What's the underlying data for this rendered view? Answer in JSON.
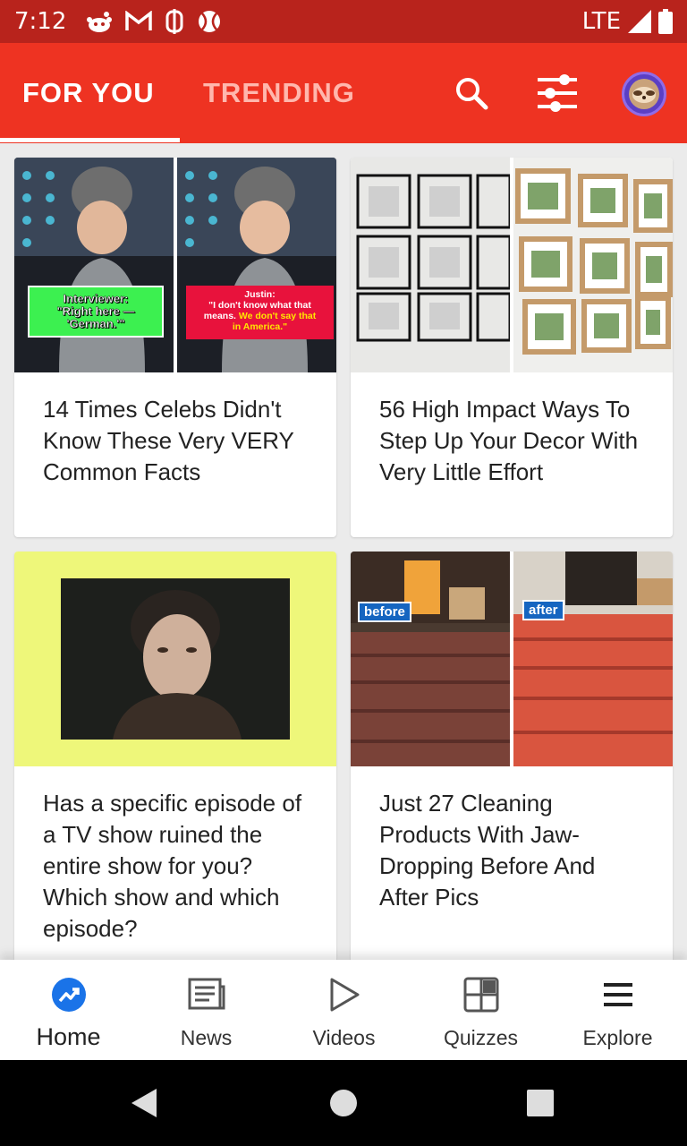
{
  "status_bar": {
    "time": "7:12",
    "network": "LTE",
    "notification_icons": [
      "reddit-icon",
      "gmail-icon",
      "buzzfeed-icon",
      "baseball-icon"
    ]
  },
  "header": {
    "tabs": [
      {
        "label": "FOR YOU",
        "active": true
      },
      {
        "label": "TRENDING",
        "active": false
      }
    ],
    "icons": [
      "search-icon",
      "filter-sliders-icon",
      "avatar-sloth-icon"
    ],
    "accent_color": "#ee3322"
  },
  "feed": {
    "cards": [
      {
        "title": "14 Times Celebs Didn't Know These Very VERY Common Facts",
        "caption_left": [
          "Interviewer:",
          "\"Right here —",
          "'German.'\""
        ],
        "caption_right_line1": "Justin:",
        "caption_right_line2": "\"I don't know what that",
        "caption_right_line3_plain": "means. ",
        "caption_right_line3_highlight": "We don't say that",
        "caption_right_line4": "in America.\""
      },
      {
        "title": "56 High Impact Ways To Step Up Your Decor With Very Little Effort"
      },
      {
        "title": "Has a specific episode of a TV show ruined the entire show for you? Which show and which episode?"
      },
      {
        "title": "Just 27 Cleaning Products With Jaw-Dropping Before And After Pics",
        "badge_before": "before",
        "badge_after": "after"
      }
    ]
  },
  "bottom_nav": {
    "items": [
      {
        "label": "Home",
        "icon": "trending-icon",
        "active": true
      },
      {
        "label": "News",
        "icon": "news-icon",
        "active": false
      },
      {
        "label": "Videos",
        "icon": "play-icon",
        "active": false
      },
      {
        "label": "Quizzes",
        "icon": "quizzes-icon",
        "active": false
      },
      {
        "label": "Explore",
        "icon": "menu-icon",
        "active": false
      }
    ]
  }
}
